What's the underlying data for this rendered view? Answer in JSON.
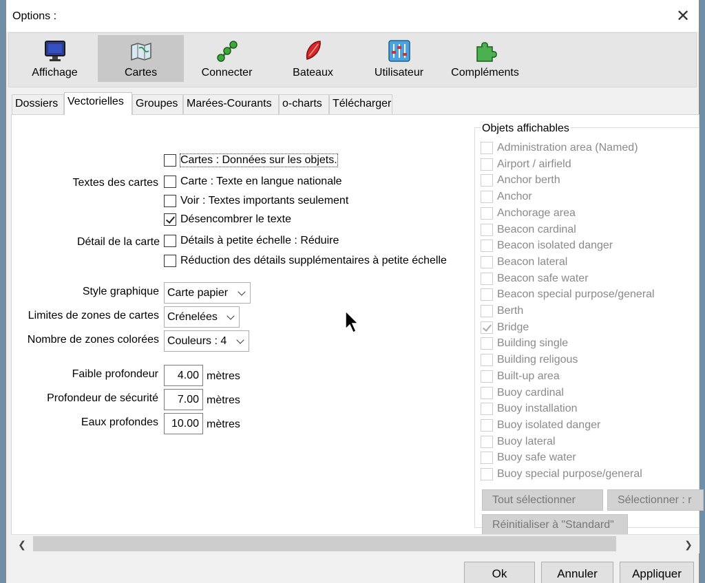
{
  "window": {
    "title": "Options :"
  },
  "toolbar": {
    "items": [
      {
        "label": "Affichage",
        "icon": "monitor-icon",
        "selected": false
      },
      {
        "label": "Cartes",
        "icon": "chart-map-icon",
        "selected": true
      },
      {
        "label": "Connecter",
        "icon": "connect-icon",
        "selected": false
      },
      {
        "label": "Bateaux",
        "icon": "boat-icon",
        "selected": false
      },
      {
        "label": "Utilisateur",
        "icon": "sliders-icon",
        "selected": false
      },
      {
        "label": "Compléments",
        "icon": "puzzle-icon",
        "selected": false
      }
    ]
  },
  "tabs": [
    "Dossiers",
    "Vectorielles",
    "Groupes",
    "Marées-Courants",
    "o-charts",
    "Télécharger"
  ],
  "active_tab": "Vectorielles",
  "settings": {
    "textes_label": "Textes des cartes",
    "detail_label": "Détail de la carte",
    "checkboxes": [
      {
        "label": "Cartes : Données sur les objets.",
        "checked": false
      },
      {
        "label": "Carte : Texte en langue nationale",
        "checked": false
      },
      {
        "label": "Voir : Textes importants seulement",
        "checked": false
      },
      {
        "label": "Désencombrer le texte",
        "checked": true
      },
      {
        "label": "Détails à petite échelle : Réduire",
        "checked": false
      },
      {
        "label": "Réduction des détails supplémentaires à petite échelle",
        "checked": false
      }
    ],
    "style_label": "Style graphique",
    "style_value": "Carte papier",
    "limits_label": "Limites de zones de cartes",
    "limits_value": "Crénelées",
    "zones_label": "Nombre de zones colorées",
    "zones_value": "Couleurs : 4",
    "shallow_label": "Faible profondeur",
    "shallow_value": "4.00",
    "safety_label": "Profondeur de sécurité",
    "safety_value": "7.00",
    "deep_label": "Eaux profondes",
    "deep_value": "10.00",
    "unit": "mètres"
  },
  "objects": {
    "title": "Objets affichables",
    "items": [
      {
        "label": "Administration area (Named)",
        "checked": false
      },
      {
        "label": "Airport / airfield",
        "checked": false
      },
      {
        "label": "Anchor berth",
        "checked": false
      },
      {
        "label": "Anchor",
        "checked": false
      },
      {
        "label": "Anchorage area",
        "checked": false
      },
      {
        "label": "Beacon cardinal",
        "checked": false
      },
      {
        "label": "Beacon isolated danger",
        "checked": false
      },
      {
        "label": "Beacon lateral",
        "checked": false
      },
      {
        "label": "Beacon safe water",
        "checked": false
      },
      {
        "label": "Beacon special purpose/general",
        "checked": false
      },
      {
        "label": "Berth",
        "checked": false
      },
      {
        "label": "Bridge",
        "checked": true
      },
      {
        "label": "Building single",
        "checked": false
      },
      {
        "label": "Building religous",
        "checked": false
      },
      {
        "label": "Built-up area",
        "checked": false
      },
      {
        "label": "Buoy cardinal",
        "checked": false
      },
      {
        "label": "Buoy installation",
        "checked": false
      },
      {
        "label": "Buoy isolated danger",
        "checked": false
      },
      {
        "label": "Buoy lateral",
        "checked": false
      },
      {
        "label": "Buoy safe water",
        "checked": false
      },
      {
        "label": "Buoy special purpose/general",
        "checked": false
      }
    ],
    "select_all": "Tout sélectionner",
    "select_none": "Sélectionner : r",
    "reset": "Réinitialiser à \"Standard\""
  },
  "buttons": {
    "ok": "Ok",
    "cancel": "Annuler",
    "apply": "Appliquer"
  }
}
